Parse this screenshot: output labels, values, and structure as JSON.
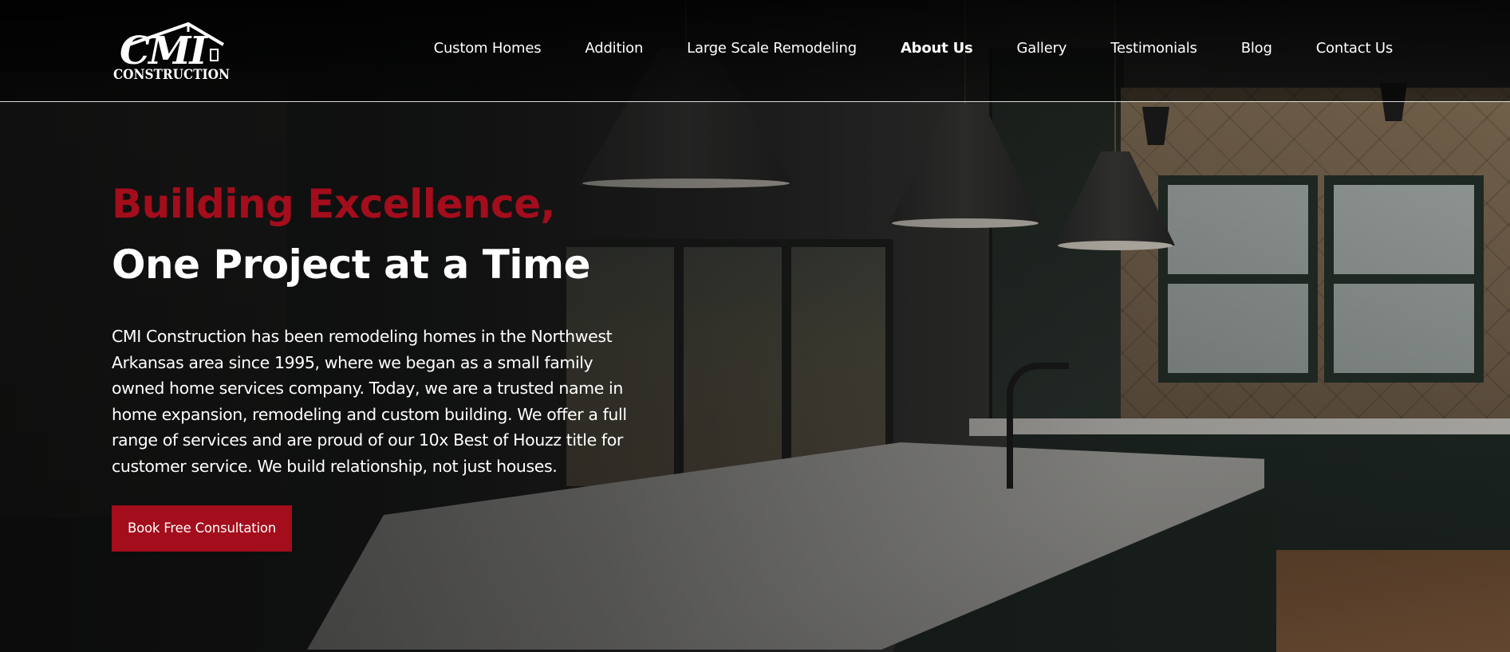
{
  "brand": {
    "logo_initials": "CMI",
    "logo_word": "CONSTRUCTION"
  },
  "nav": {
    "items": [
      {
        "label": "Custom Homes"
      },
      {
        "label": "Addition"
      },
      {
        "label": "Large Scale Remodeling"
      },
      {
        "label": "About Us",
        "active": true
      },
      {
        "label": "Gallery"
      },
      {
        "label": "Testimonials"
      },
      {
        "label": "Blog"
      },
      {
        "label": "Contact Us"
      }
    ]
  },
  "hero": {
    "title_line1": "Building Excellence,",
    "title_line2": "One Project at a Time",
    "description": "CMI Construction has been remodeling homes in the Northwest Arkansas area since 1995, where we began as a small family owned home services company. Today, we are a trusted name in home expansion, remodeling and custom building. We offer a full range of services and are proud of our 10x Best of Houzz title for customer service. We build relationship, not just houses.",
    "cta_label": "Book Free Consultation"
  },
  "colors": {
    "accent": "#a30d1c",
    "text": "#ffffff",
    "background": "#0e0f0f"
  }
}
